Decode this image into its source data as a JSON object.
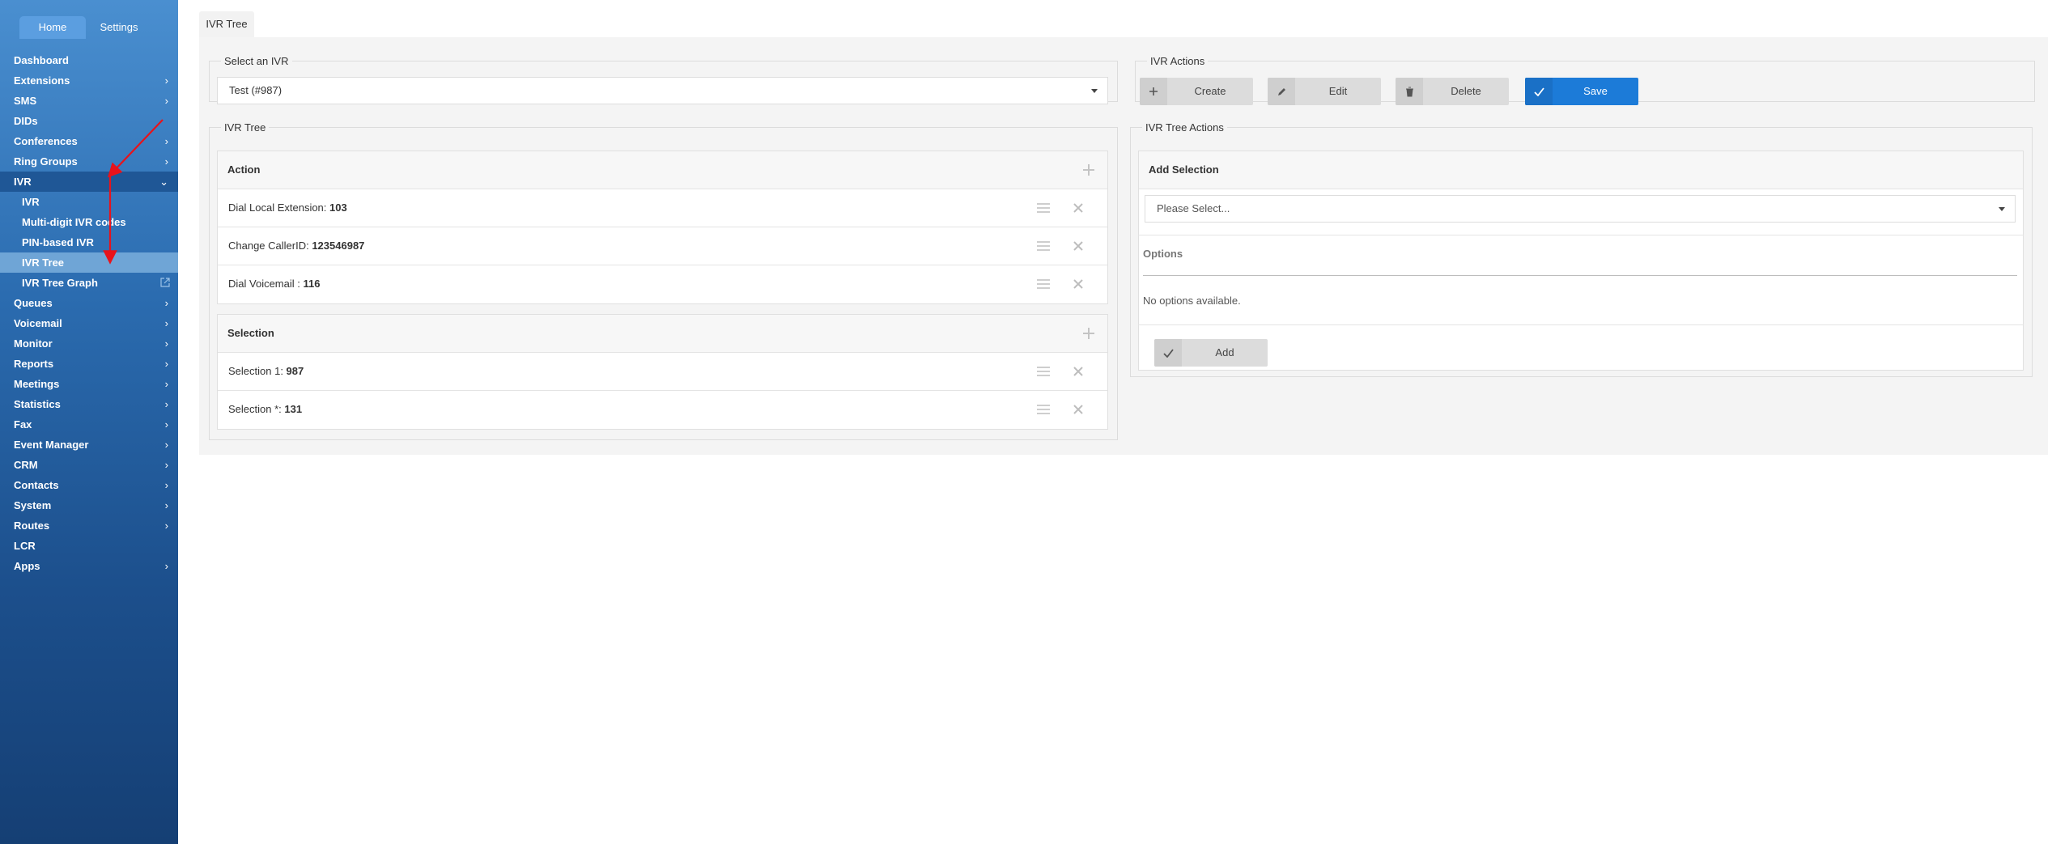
{
  "sidebar": {
    "tabs": [
      {
        "label": "Home",
        "active": true
      },
      {
        "label": "Settings",
        "active": false
      }
    ],
    "menu": [
      {
        "label": "Dashboard"
      },
      {
        "label": "Extensions"
      },
      {
        "label": "SMS"
      },
      {
        "label": "DIDs"
      },
      {
        "label": "Conferences"
      },
      {
        "label": "Ring Groups"
      },
      {
        "label": "IVR"
      },
      {
        "label": "IVR"
      },
      {
        "label": "Multi-digit IVR codes"
      },
      {
        "label": "PIN-based IVR"
      },
      {
        "label": "IVR Tree"
      },
      {
        "label": "IVR Tree Graph"
      },
      {
        "label": "Queues"
      },
      {
        "label": "Voicemail"
      },
      {
        "label": "Monitor"
      },
      {
        "label": "Reports"
      },
      {
        "label": "Meetings"
      },
      {
        "label": "Statistics"
      },
      {
        "label": "Fax"
      },
      {
        "label": "Event Manager"
      },
      {
        "label": "CRM"
      },
      {
        "label": "Contacts"
      },
      {
        "label": "System"
      },
      {
        "label": "Routes"
      },
      {
        "label": "LCR"
      },
      {
        "label": "Apps"
      }
    ]
  },
  "page_tab": "IVR Tree",
  "select_ivr": {
    "legend": "Select an IVR",
    "value": "Test (#987)"
  },
  "ivr_actions": {
    "legend": "IVR Actions",
    "create": "Create",
    "edit": "Edit",
    "delete": "Delete",
    "save": "Save"
  },
  "ivr_tree": {
    "legend": "IVR Tree",
    "action_header": "Action",
    "actions": [
      {
        "label": "Dial Local Extension: ",
        "value": "103"
      },
      {
        "label": "Change CallerID: ",
        "value": "123546987"
      },
      {
        "label": "Dial Voicemail : ",
        "value": "116"
      }
    ],
    "selection_header": "Selection",
    "selections": [
      {
        "label": "Selection 1: ",
        "value": "987"
      },
      {
        "label": "Selection *: ",
        "value": "131"
      }
    ]
  },
  "tree_actions": {
    "legend": "IVR Tree Actions",
    "add_selection_header": "Add Selection",
    "select_placeholder": "Please Select...",
    "options_label": "Options",
    "no_options": "No options available.",
    "add": "Add"
  },
  "colors": {
    "primary": "#1c7bd8",
    "annotation": "#e8131b"
  }
}
